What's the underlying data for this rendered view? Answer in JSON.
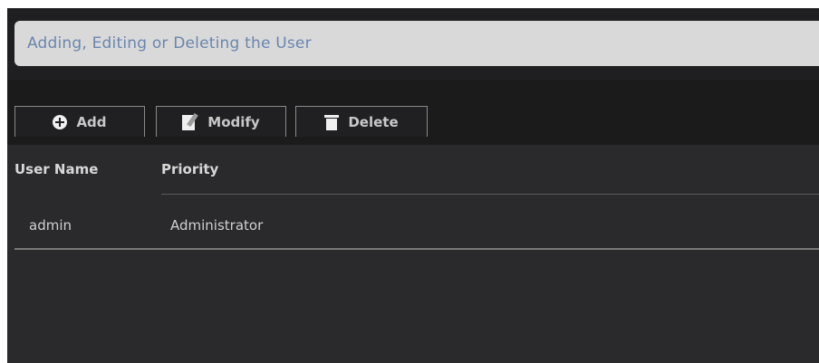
{
  "title": "Adding, Editing or Deleting the User",
  "toolbar": {
    "add_label": "Add",
    "modify_label": "Modify",
    "delete_label": "Delete"
  },
  "table": {
    "columns": [
      "User Name",
      "Priority"
    ],
    "rows": [
      {
        "user_name": "admin",
        "priority": "Administrator"
      }
    ]
  },
  "icons": {
    "add": "plus-circle-icon",
    "modify": "edit-icon",
    "delete": "trash-icon"
  },
  "colors": {
    "title_text": "#6a86ad",
    "background": "#1f1f21"
  }
}
